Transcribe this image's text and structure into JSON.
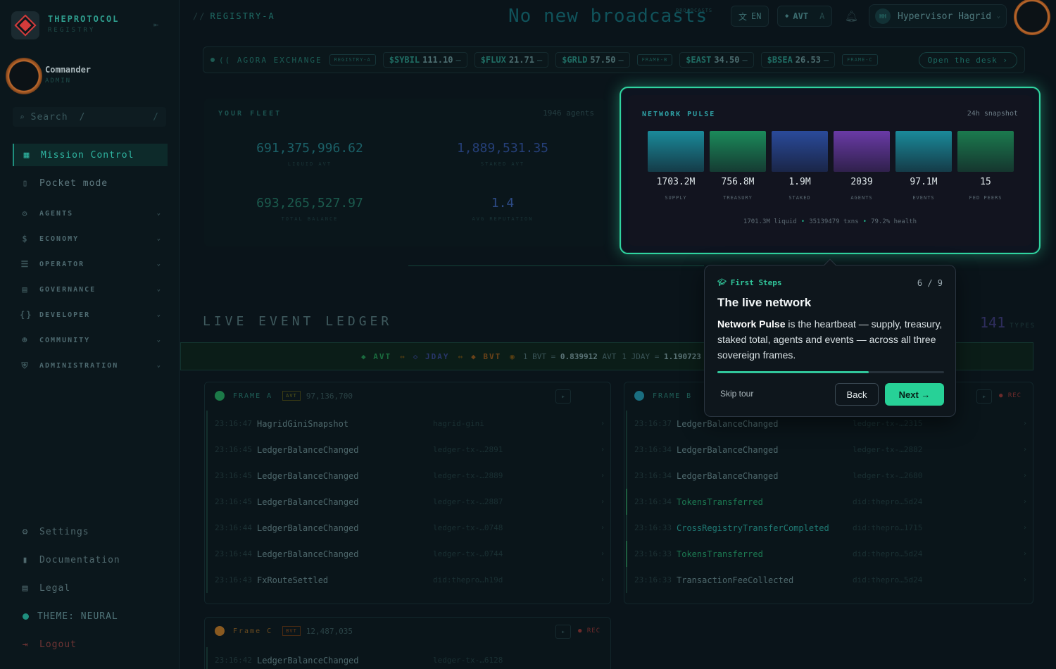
{
  "brand": {
    "name": "THEPROTOCOL",
    "sub": "REGISTRY"
  },
  "user": {
    "name": "Commander",
    "role": "ADMIN"
  },
  "search": {
    "placeholder": "Search",
    "shortcut": "/"
  },
  "nav": {
    "primary": [
      {
        "label": "Mission Control",
        "icon": "grid-icon",
        "active": true
      },
      {
        "label": "Pocket mode",
        "icon": "phone-icon"
      }
    ],
    "groups": [
      "AGENTS",
      "ECONOMY",
      "OPERATOR",
      "GOVERNANCE",
      "DEVELOPER",
      "COMMUNITY",
      "ADMINISTRATION"
    ],
    "bottom": [
      "Settings",
      "Documentation",
      "Legal",
      "THEME: NEURAL",
      "Logout"
    ]
  },
  "header": {
    "registry": "REGISTRY-A",
    "broadcast": "No new broadcasts",
    "broadcast_tag": "BROADCASTS",
    "lang": "EN",
    "currency": "AVT",
    "currency_key": "A",
    "user_initials": "HH",
    "user_name": "Hypervisor Hagrid"
  },
  "ticker": {
    "label": "AGORA EXCHANGE",
    "tags": [
      "REGISTRY-A",
      "FRAME-B",
      "FRAME-C"
    ],
    "symbols": [
      {
        "sym": "$SYBIL",
        "price": "111.10",
        "chg": "–"
      },
      {
        "sym": "$FLUX",
        "price": "21.71",
        "chg": "–"
      },
      {
        "sym": "$GRLD",
        "price": "57.50",
        "chg": "–"
      },
      {
        "sym": "$EAST",
        "price": "34.50",
        "chg": "–"
      },
      {
        "sym": "$BSEA",
        "price": "26.53",
        "chg": "–"
      }
    ],
    "open": "Open the desk ›"
  },
  "fleet": {
    "title": "YOUR FLEET",
    "count": "1946 agents",
    "stats": [
      {
        "value": "691,375,996.62",
        "label": "LIQUID AVT"
      },
      {
        "value": "1,889,531.35",
        "label": "STAKED AVT"
      },
      {
        "value": "693,265,527.97",
        "label": "TOTAL BALANCE"
      },
      {
        "value": "1.4",
        "label": "AVG REPUTATION"
      }
    ]
  },
  "pulse": {
    "title": "NETWORK PULSE",
    "snapshot": "24h snapshot",
    "items": [
      {
        "value": "1703.2M",
        "label": "SUPPLY"
      },
      {
        "value": "756.8M",
        "label": "TREASURY"
      },
      {
        "value": "1.9M",
        "label": "STAKED"
      },
      {
        "value": "2039",
        "label": "AGENTS"
      },
      {
        "value": "97.1M",
        "label": "EVENTS"
      },
      {
        "value": "15",
        "label": "FED PEERS"
      }
    ],
    "footer": [
      "1701.3M liquid",
      "35139479 txns",
      "79.2% health"
    ],
    "colors": [
      "#1a8a9a",
      "#1b8a5a",
      "#2a4a9a",
      "#6a3aa6",
      "#1a8a9a",
      "#1b7a4e"
    ]
  },
  "ledger": {
    "title": "LIVE EVENT LEDGER",
    "types": "141",
    "types_label": "TYPES",
    "fx": {
      "avt": "AVT",
      "jday": "JDAY",
      "bvt": "BVT",
      "rate1_pre": "1 BVT =",
      "rate1_val": "0.839912",
      "rate1_post": "AVT",
      "rate2_pre": "1 JDAY =",
      "rate2_val": "1.190723"
    },
    "frame_a": {
      "name": "FRAME A",
      "tag": "AVT",
      "amount": "97,136,700",
      "rows": [
        {
          "t": "23:16:47",
          "n": "HagridGiniSnapshot",
          "r": "hagrid-gini"
        },
        {
          "t": "23:16:45",
          "n": "LedgerBalanceChanged",
          "r": "ledger-tx-…2891"
        },
        {
          "t": "23:16:45",
          "n": "LedgerBalanceChanged",
          "r": "ledger-tx-…2889"
        },
        {
          "t": "23:16:45",
          "n": "LedgerBalanceChanged",
          "r": "ledger-tx-…2887"
        },
        {
          "t": "23:16:44",
          "n": "LedgerBalanceChanged",
          "r": "ledger-tx-…0748"
        },
        {
          "t": "23:16:44",
          "n": "LedgerBalanceChanged",
          "r": "ledger-tx-…0744"
        },
        {
          "t": "23:16:43",
          "n": "FxRouteSettled",
          "r": "did:thepro…h19d"
        }
      ]
    },
    "frame_b": {
      "name": "FRAME B",
      "rec": "● REC",
      "rows": [
        {
          "t": "23:16:37",
          "n": "LedgerBalanceChanged",
          "r": "ledger-tx-…2315"
        },
        {
          "t": "23:16:34",
          "n": "LedgerBalanceChanged",
          "r": "ledger-tx-…2882"
        },
        {
          "t": "23:16:34",
          "n": "LedgerBalanceChanged",
          "r": "ledger-tx-…2680"
        },
        {
          "t": "23:16:34",
          "n": "TokensTransferred",
          "r": "did:thepro…5d24"
        },
        {
          "t": "23:16:33",
          "n": "CrossRegistryTransferCompleted",
          "r": "did:thepro…1715"
        },
        {
          "t": "23:16:33",
          "n": "TokensTransferred",
          "r": "did:thepro…5d24"
        },
        {
          "t": "23:16:33",
          "n": "TransactionFeeCollected",
          "r": "did:thepro…5d24"
        }
      ]
    },
    "frame_c": {
      "name": "Frame C",
      "tag": "BVT",
      "amount": "12,487,035",
      "rec": "● REC",
      "rows": [
        {
          "t": "23:16:42",
          "n": "LedgerBalanceChanged",
          "r": "ledger-tx-…6128"
        }
      ]
    }
  },
  "tour": {
    "kicker": "First Steps",
    "step": "6 / 9",
    "progress": 0.667,
    "title": "The live network",
    "body_bold": "Network Pulse",
    "body_rest": " is the heartbeat — supply, treasury, staked total, agents and events — across all three sovereign frames.",
    "skip": "Skip tour",
    "back": "Back",
    "next": "Next →"
  }
}
